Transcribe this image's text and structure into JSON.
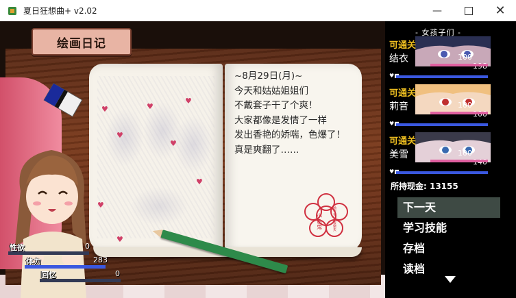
{
  "window": {
    "title": "夏日狂想曲+ v2.02",
    "minimize_icon": "minimize-icon",
    "maximize_icon": "maximize-icon",
    "close_icon": "close-icon"
  },
  "scene": {
    "title": "绘画日记",
    "diary_lines": [
      "~8月29日(月)~",
      "今天和姑姑姐姐们",
      "不戴套子干了个爽！",
      "大家都像是发情了一样",
      "发出香艳的娇喘，色爆了！",
      "真是爽翻了……"
    ],
    "stamp_text": "小色鬼",
    "stamp_sub": "前今天 夫去做夫"
  },
  "status": {
    "items": [
      {
        "label": "性欲",
        "value": "0",
        "fill": 0.0,
        "color": "#e060a0"
      },
      {
        "label": "体力",
        "value": "283",
        "fill": 1.0,
        "color": "#3a58e0"
      },
      {
        "label": "回忆",
        "value": "0",
        "fill": 0.0,
        "color": "#e0c040"
      }
    ]
  },
  "panel": {
    "header": "- 女孩子们 -",
    "girls": [
      {
        "tag": "可通关",
        "name": "结衣",
        "num1": "100",
        "num2": "198",
        "hair": "#2a2f52",
        "eye": "#4a5ab0"
      },
      {
        "tag": "可通关",
        "name": "莉音",
        "num1": "100",
        "num2": "100",
        "hair": "#f0c080",
        "eye": "#c03030"
      },
      {
        "tag": "可通关",
        "name": "美雪",
        "num1": "100",
        "num2": "140",
        "hair": "#3a3a4a",
        "eye": "#3a6ab0"
      }
    ],
    "money_label": "所持现金: ",
    "money_value": "13155",
    "menu": [
      {
        "label": "下一天",
        "selected": true
      },
      {
        "label": "学习技能",
        "selected": false
      },
      {
        "label": "存档",
        "selected": false
      },
      {
        "label": "读档",
        "selected": false
      }
    ],
    "more_icon": "down-arrow-icon"
  }
}
